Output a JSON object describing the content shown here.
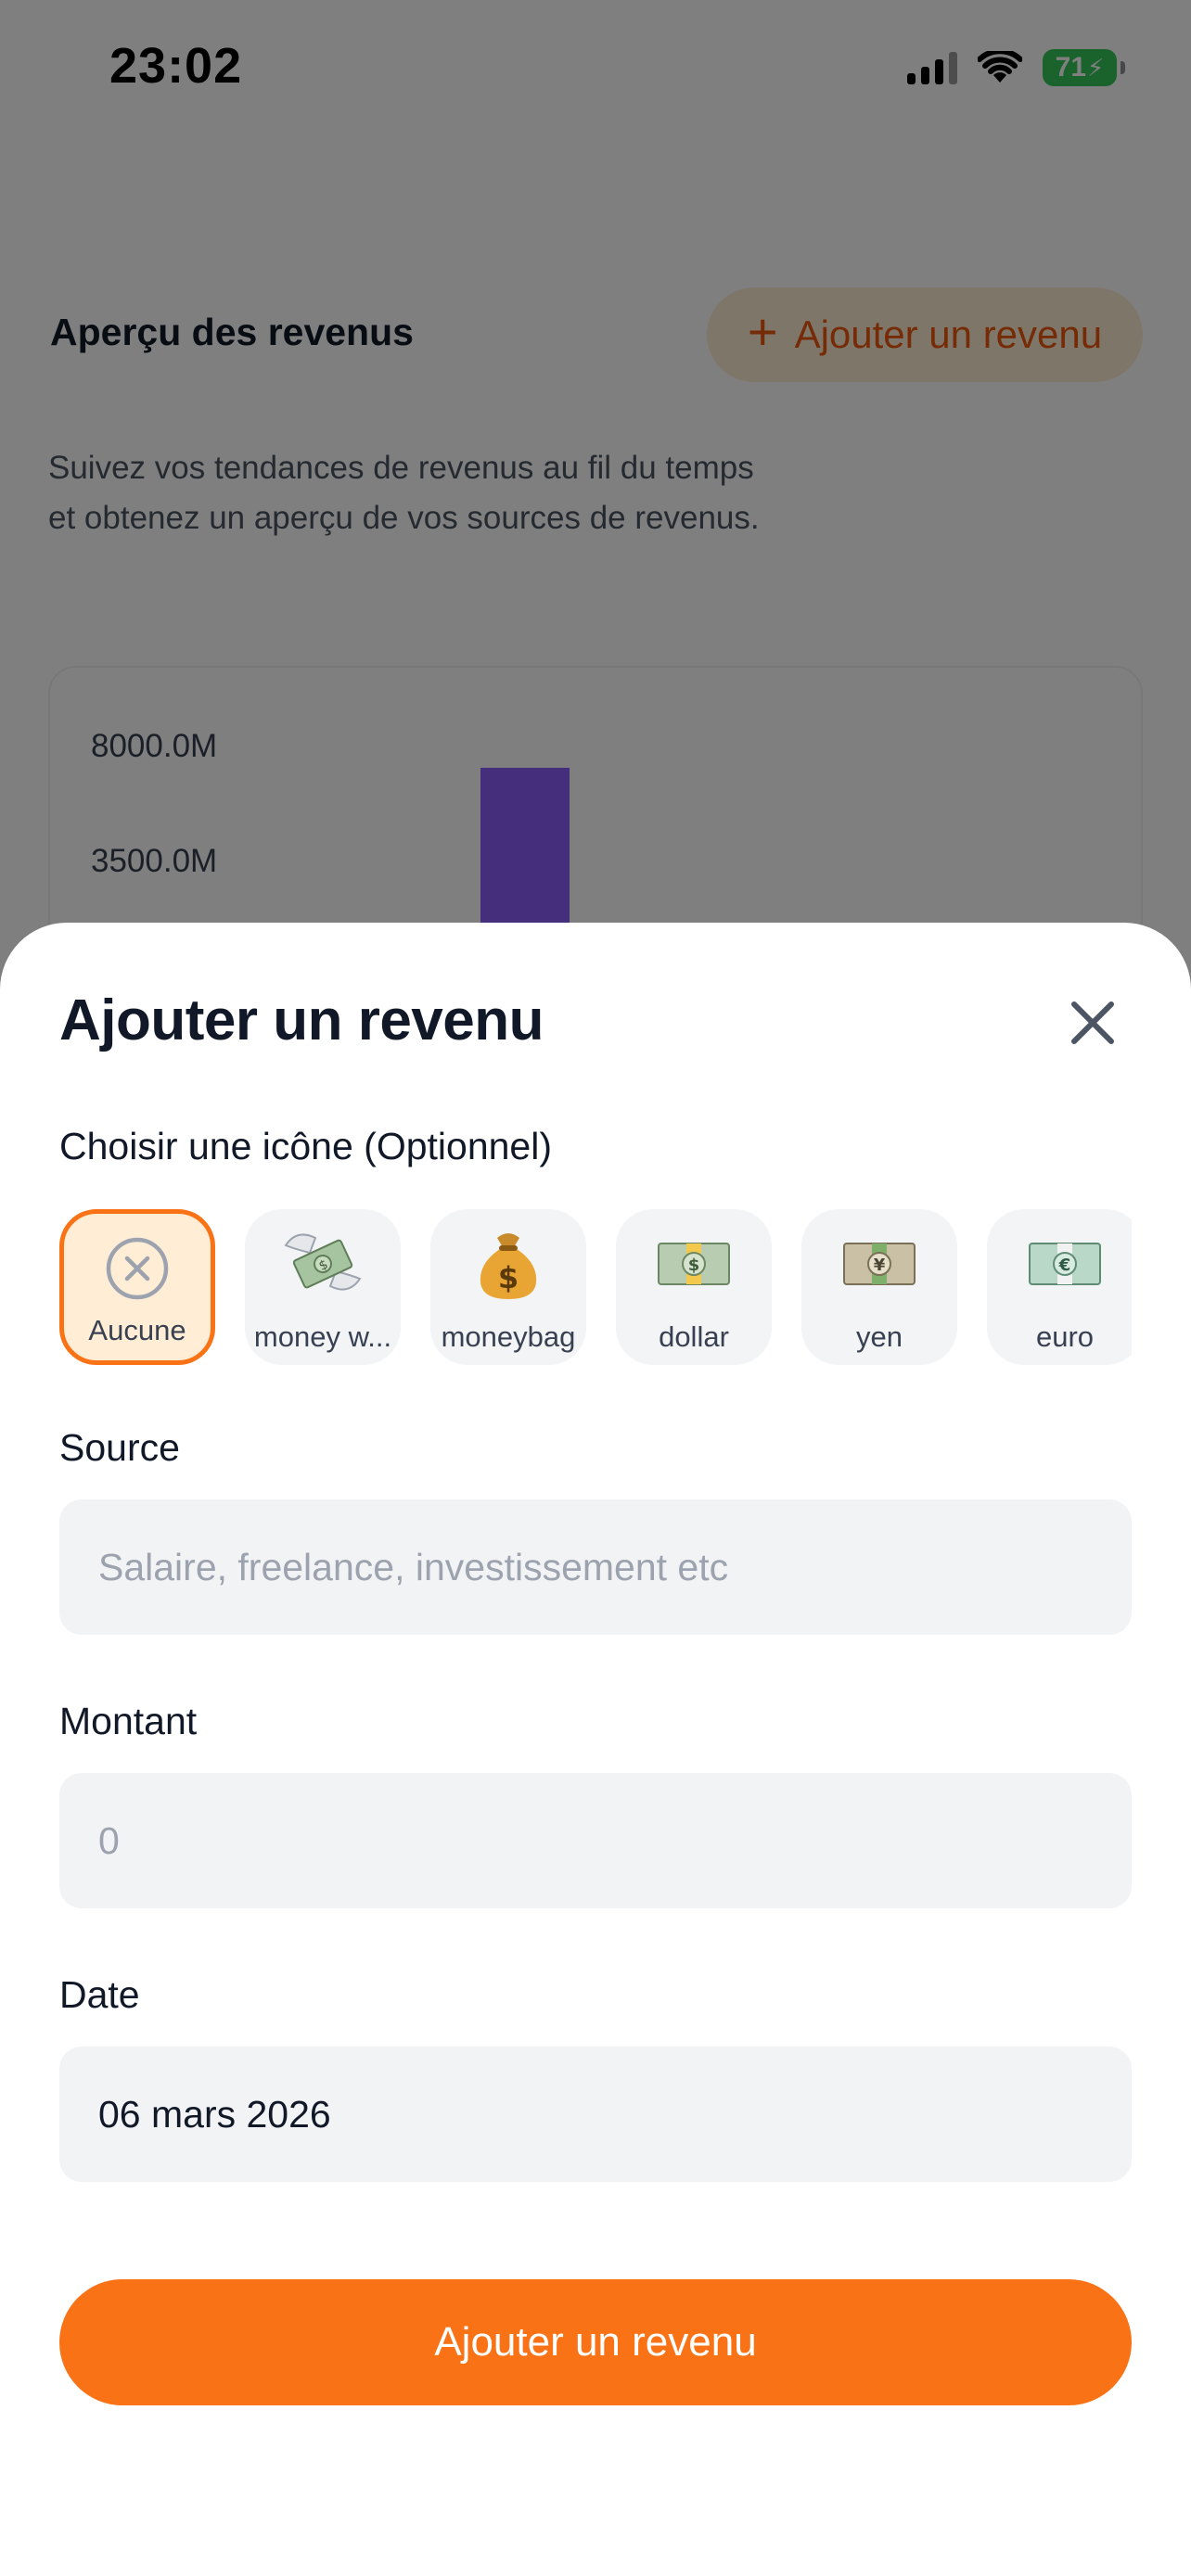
{
  "status_bar": {
    "time": "23:02",
    "battery": "71"
  },
  "overview": {
    "title": "Aperçu des revenus",
    "add_button_label": "Ajouter un revenu",
    "description_line1": "Suivez vos tendances de revenus au fil du temps",
    "description_line2": "et obtenez un aperçu de vos sources de revenus."
  },
  "chart_data": {
    "type": "bar",
    "categories": [
      ""
    ],
    "values": [
      8000
    ],
    "y_ticks": [
      "8000.0M",
      "3500.0M"
    ],
    "title": "",
    "xlabel": "",
    "ylabel": "",
    "colors": {
      "bar": "#8b5cf6"
    }
  },
  "sheet": {
    "title": "Ajouter un revenu",
    "icon_label": "Choisir une icône (Optionnel)",
    "icons": [
      {
        "label": "Aucune",
        "icon": "none-circle-x-icon",
        "selected": true
      },
      {
        "label": "money w...",
        "icon": "money-with-wings-icon"
      },
      {
        "label": "moneybag",
        "icon": "moneybag-icon"
      },
      {
        "label": "dollar",
        "icon": "dollar-banknote-icon"
      },
      {
        "label": "yen",
        "icon": "yen-banknote-icon"
      },
      {
        "label": "euro",
        "icon": "euro-banknote-icon"
      }
    ],
    "source_label": "Source",
    "source_placeholder": "Salaire, freelance, investissement etc",
    "amount_label": "Montant",
    "amount_placeholder": "0",
    "date_label": "Date",
    "date_value": "06 mars 2026",
    "submit_label": "Ajouter un revenu"
  },
  "colors": {
    "accent": "#f97316",
    "accent_light": "#ffedd5",
    "field_bg": "#f2f3f5",
    "overlay": "rgba(0,0,0,0.5)"
  }
}
